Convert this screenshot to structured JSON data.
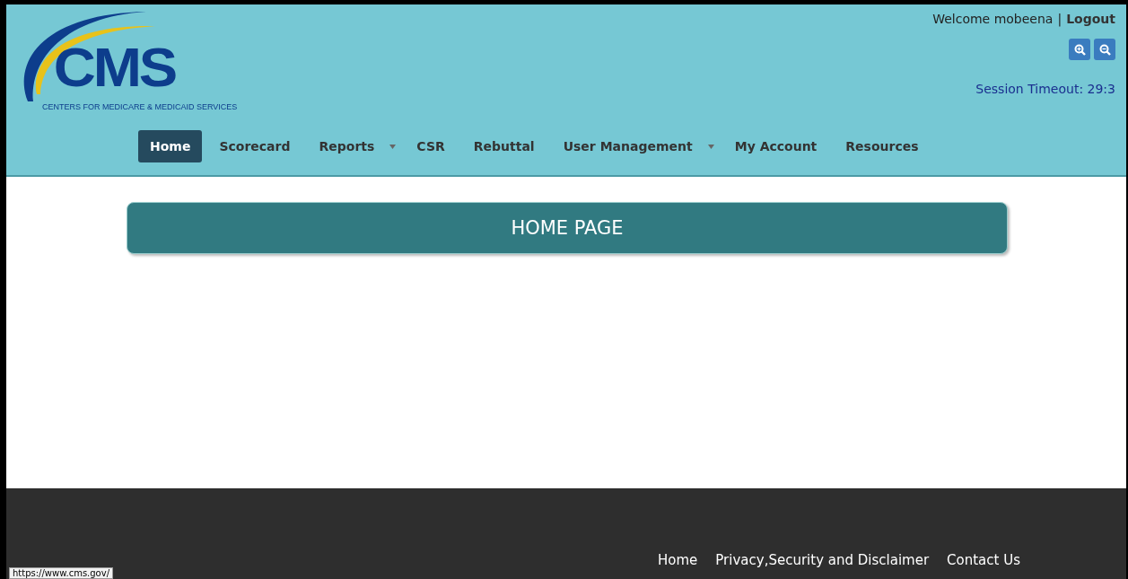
{
  "header": {
    "logo": {
      "letters": "CMS",
      "tagline": "CENTERS FOR MEDICARE & MEDICAID SERVICES"
    },
    "user": {
      "welcome": "Welcome mobeena",
      "separator": "|",
      "logout": "Logout"
    },
    "zoom_buttons": [
      {
        "kind": "zoom-in"
      },
      {
        "kind": "zoom-out"
      }
    ],
    "session_timeout": "Session Timeout: 29:3"
  },
  "nav": [
    {
      "label": "Home",
      "selected": true,
      "dropdown": false
    },
    {
      "label": "Scorecard",
      "selected": false,
      "dropdown": false
    },
    {
      "label": "Reports",
      "selected": false,
      "dropdown": true
    },
    {
      "label": "CSR",
      "selected": false,
      "dropdown": false
    },
    {
      "label": "Rebuttal",
      "selected": false,
      "dropdown": false
    },
    {
      "label": "User Management",
      "selected": false,
      "dropdown": true
    },
    {
      "label": "My Account",
      "selected": false,
      "dropdown": false
    },
    {
      "label": "Resources",
      "selected": false,
      "dropdown": false
    }
  ],
  "page_banner": "HOME PAGE",
  "footer": {
    "links": [
      "Home",
      "Privacy,Security and Disclaimer",
      "Contact Us"
    ]
  },
  "status_url": "https://www.cms.gov/"
}
